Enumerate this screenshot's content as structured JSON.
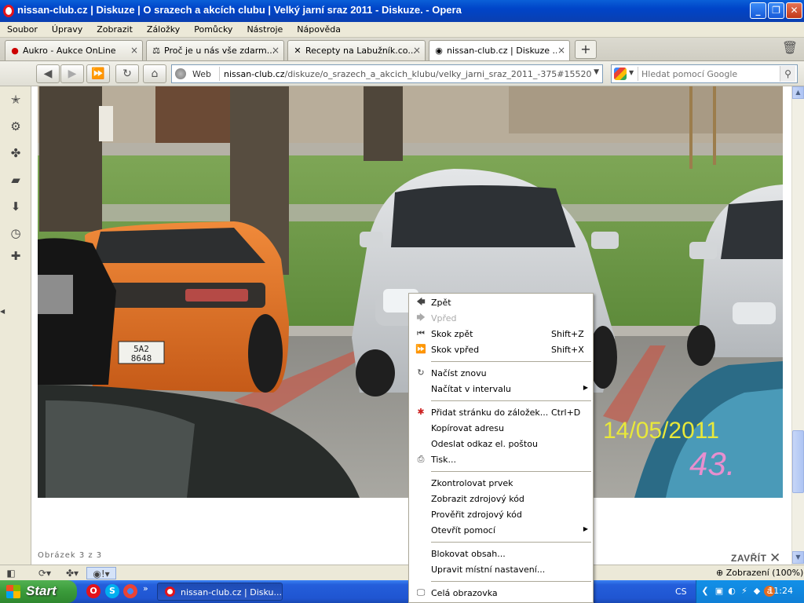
{
  "window": {
    "title": "nissan-club.cz | Diskuze | O srazech a akcích clubu | Velký jarní sraz 2011 - Diskuze. - Opera",
    "minimize": "_",
    "maximize": "❐",
    "close": "✕"
  },
  "menubar": [
    "Soubor",
    "Úpravy",
    "Zobrazit",
    "Záložky",
    "Pomůcky",
    "Nástroje",
    "Nápověda"
  ],
  "tabs": [
    {
      "label": "Aukro - Aukce OnLine",
      "icon": "aukro-icon"
    },
    {
      "label": "Proč je u nás vše zdarm...",
      "icon": "scales-icon"
    },
    {
      "label": "Recepty na Labužník.co...",
      "icon": "cutlery-icon"
    },
    {
      "label": "nissan-club.cz | Diskuze ...",
      "icon": "nissan-icon"
    }
  ],
  "tab_close": "×",
  "new_tab": "+",
  "address": {
    "web_label": "Web",
    "url_host": "nissan-club.cz",
    "url_path": "/diskuze/o_srazech_a_akcich_klubu/velky_jarni_sraz_2011_-375#15520"
  },
  "search": {
    "placeholder": "Hledat pomocí Google"
  },
  "page": {
    "caption": "Obrázek 3 z 3",
    "close_label": "ZAVŘÍT",
    "close_x": "✕",
    "photo_date": "14/05/2011",
    "photo_number": "43."
  },
  "context_menu": {
    "items": [
      {
        "label": "Zpět",
        "shortcut": "",
        "icon": "back-arrow-icon",
        "disabled": false
      },
      {
        "label": "Vpřed",
        "shortcut": "",
        "icon": "forward-arrow-icon",
        "disabled": true
      },
      {
        "label": "Skok zpět",
        "shortcut": "Shift+Z",
        "icon": "rewind-icon",
        "disabled": false
      },
      {
        "label": "Skok vpřed",
        "shortcut": "Shift+X",
        "icon": "fast-forward-icon",
        "disabled": false
      },
      {
        "label": "Načíst znovu",
        "shortcut": "",
        "icon": "reload-icon",
        "disabled": false
      },
      {
        "label": "Načítat v intervalu",
        "shortcut": "",
        "icon": "",
        "disabled": false,
        "submenu": true
      },
      {
        "label": "Přidat stránku do záložek...",
        "shortcut": "Ctrl+D",
        "icon": "bookmark-icon",
        "disabled": false
      },
      {
        "label": "Kopírovat adresu",
        "shortcut": "",
        "icon": "",
        "disabled": false
      },
      {
        "label": "Odeslat odkaz el. poštou",
        "shortcut": "",
        "icon": "",
        "disabled": false
      },
      {
        "label": "Tisk...",
        "shortcut": "",
        "icon": "printer-icon",
        "disabled": false
      },
      {
        "label": "Zkontrolovat prvek",
        "shortcut": "",
        "icon": "",
        "disabled": false
      },
      {
        "label": "Zobrazit zdrojový kód",
        "shortcut": "",
        "icon": "",
        "disabled": false
      },
      {
        "label": "Prověřit zdrojový kód",
        "shortcut": "",
        "icon": "",
        "disabled": false
      },
      {
        "label": "Otevřít pomocí",
        "shortcut": "",
        "icon": "",
        "disabled": false,
        "submenu": true
      },
      {
        "label": "Blokovat obsah...",
        "shortcut": "",
        "icon": "",
        "disabled": false
      },
      {
        "label": "Upravit místní nastavení...",
        "shortcut": "",
        "icon": "",
        "disabled": false
      },
      {
        "label": "Celá obrazovka",
        "shortcut": "",
        "icon": "monitor-icon",
        "disabled": false
      }
    ]
  },
  "statusbar": {
    "zoom": "Zobrazení (100%)"
  },
  "taskbar": {
    "start": "Start",
    "window_button": "nissan-club.cz | Disku...",
    "lang": "CS",
    "clock": "11:24",
    "chevron": "»"
  },
  "colors": {
    "titlebar": "#0a5fd8",
    "taskbar": "#245edb",
    "start": "#3a9a3a",
    "date_stamp": "#e8e83a",
    "car_orange": "#e8722a"
  }
}
